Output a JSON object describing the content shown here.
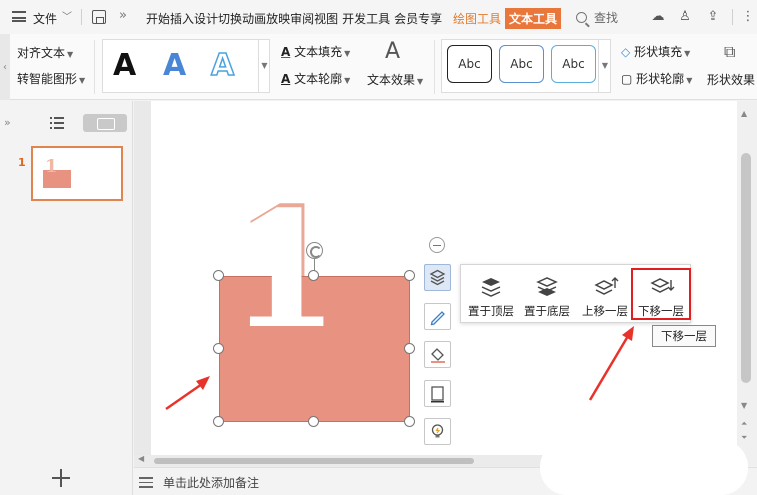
{
  "menubar": {
    "file": "文件",
    "tabs": [
      "开始",
      "插入",
      "设计",
      "切换",
      "动画",
      "放映",
      "审阅",
      "视图",
      "开发工具",
      "会员专享"
    ],
    "context_tab_draw": "绘图工具",
    "context_tab_text": "文本工具",
    "search": "查找"
  },
  "ribbon": {
    "align_text": "对齐文本",
    "to_smartart": "转智能图形",
    "text_fill": "文本填充",
    "text_outline": "文本轮廓",
    "text_effect": "文本效果",
    "shape_fill": "形状填充",
    "shape_outline": "形状轮廓",
    "shape_effect": "形状效果",
    "wordart_sample": "A",
    "abc_samples": [
      "Abc",
      "Abc",
      "Abc"
    ]
  },
  "slides": {
    "current_number": "1",
    "thumb_text": "1"
  },
  "slide_content": {
    "big_number": "1"
  },
  "layer_menu": {
    "items": [
      "置于顶层",
      "置于底层",
      "上移一层",
      "下移一层"
    ],
    "tooltip": "下移一层"
  },
  "notes": {
    "placeholder": "单击此处添加备注"
  },
  "colors": {
    "accent_orange": "#e9763a",
    "shape_fill": "#e89282",
    "highlight_red": "#e02020",
    "arrow_red": "#e8332a"
  }
}
